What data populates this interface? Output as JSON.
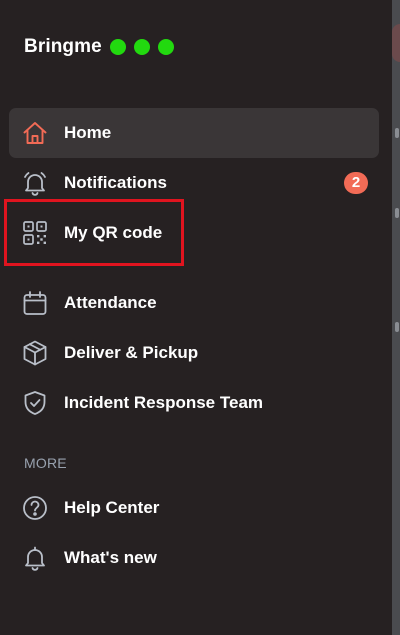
{
  "brand": {
    "name": "Bringme",
    "dot_count": 3,
    "dot_color": "#22d90f"
  },
  "nav": {
    "items": [
      {
        "id": "home",
        "label": "Home",
        "icon": "home-icon",
        "active": true,
        "accent": "#f26b56"
      },
      {
        "id": "notifications",
        "label": "Notifications",
        "icon": "bell-icon",
        "badge": "2"
      },
      {
        "id": "my-qr-code",
        "label": "My QR code",
        "icon": "qr-code-icon",
        "highlighted": true
      },
      {
        "id": "attendance",
        "label": "Attendance",
        "icon": "calendar-icon"
      },
      {
        "id": "deliver-pickup",
        "label": "Deliver & Pickup",
        "icon": "package-icon"
      },
      {
        "id": "incident-response-team",
        "label": "Incident Response Team",
        "icon": "shield-check-icon"
      }
    ]
  },
  "more": {
    "title": "MORE",
    "items": [
      {
        "id": "help-center",
        "label": "Help Center",
        "icon": "help-circle-icon"
      },
      {
        "id": "whats-new",
        "label": "What's new",
        "icon": "bell-icon"
      }
    ]
  },
  "colors": {
    "sidebar_bg": "#262122",
    "active_bg": "#3a3637",
    "icon_muted": "#b9bfc9",
    "badge_bg": "#f26b56",
    "highlight_border": "#e0141f"
  }
}
